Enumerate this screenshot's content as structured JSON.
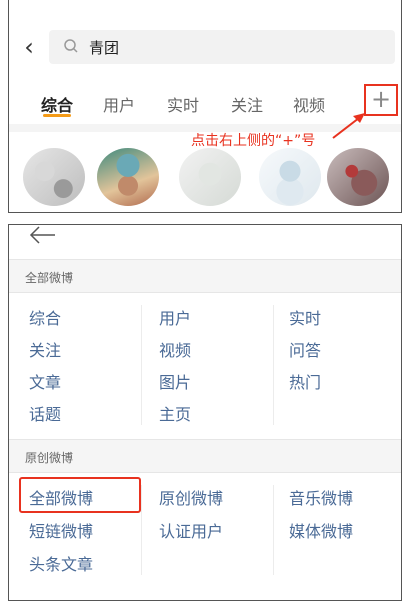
{
  "top": {
    "search_query": "青团",
    "tabs": [
      "综合",
      "用户",
      "实时",
      "关注",
      "视频"
    ],
    "plus_label": "+",
    "hint": "点击右上侧的“+”号"
  },
  "bottom": {
    "section1": {
      "title": "全部微博",
      "col1": [
        "综合",
        "关注",
        "文章",
        "话题"
      ],
      "col2": [
        "用户",
        "视频",
        "图片",
        "主页"
      ],
      "col3": [
        "实时",
        "问答",
        "热门"
      ]
    },
    "section2": {
      "title": "原创微博",
      "col1": [
        "全部微博",
        "短链微博",
        "头条文章"
      ],
      "col2": [
        "原创微博",
        "认证用户"
      ],
      "col3": [
        "音乐微博",
        "媒体微博"
      ]
    }
  },
  "colors": {
    "accent": "#f59b17",
    "annotation": "#e8321f",
    "link": "#4a6a96"
  },
  "icons": [
    "back-icon",
    "search-icon",
    "plus-icon",
    "arrow-left-icon"
  ]
}
